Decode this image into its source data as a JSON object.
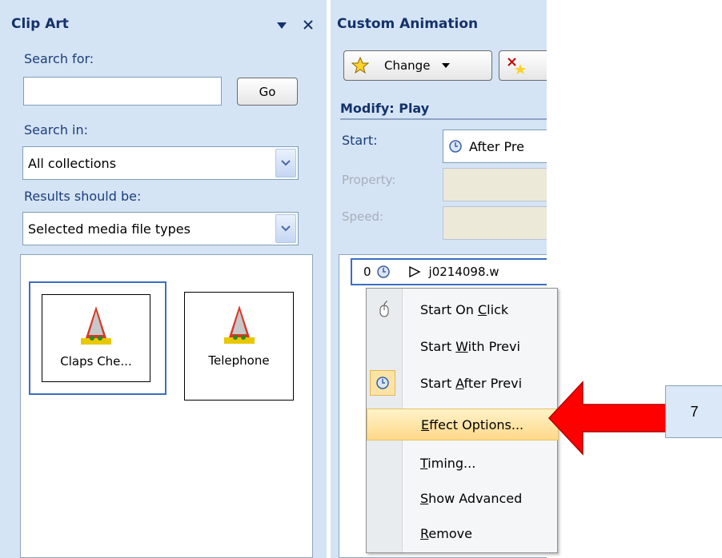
{
  "clip_art": {
    "title": "Clip Art",
    "search_for_label": "Search for:",
    "search_value": "",
    "go_button": "Go",
    "search_in_label": "Search in:",
    "search_in_value": "All collections",
    "results_label": "Results should be:",
    "results_value": "Selected media file types",
    "results": [
      {
        "label": "Claps Che..."
      },
      {
        "label": "Telephone"
      }
    ]
  },
  "custom_animation": {
    "title": "Custom Animation",
    "change_button": "Change",
    "modify_label": "Modify: Play",
    "start_label": "Start:",
    "start_value": "After Pre",
    "property_label": "Property:",
    "speed_label": "Speed:",
    "list_item": {
      "index": "0",
      "name": "j0214098.w"
    }
  },
  "context_menu": {
    "items": [
      {
        "pre": "Start On ",
        "key": "C",
        "post": "lick"
      },
      {
        "pre": "Start ",
        "key": "W",
        "post": "ith Previ"
      },
      {
        "pre": "Start ",
        "key": "A",
        "post": "fter Previ"
      },
      {
        "pre": "",
        "key": "E",
        "post": "ffect Options..."
      },
      {
        "pre": "",
        "key": "T",
        "post": "iming..."
      },
      {
        "pre": "",
        "key": "S",
        "post": "how Advanced"
      },
      {
        "pre": "",
        "key": "R",
        "post": "emove"
      }
    ]
  },
  "callout": {
    "number": "7"
  },
  "colors": {
    "arrow": "#ff0000",
    "highlight": "#ffd88a",
    "title": "#13326b"
  }
}
